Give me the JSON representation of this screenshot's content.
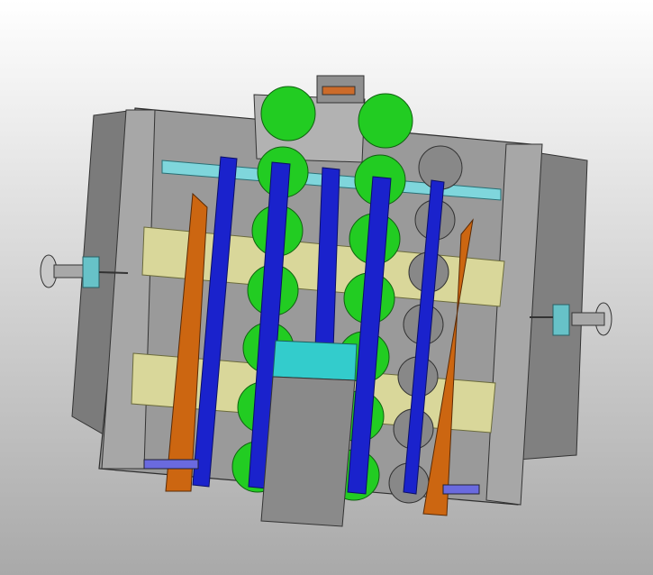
{
  "viewer": {
    "background_top": "#ffffff",
    "background_bottom": "#a9a9a9"
  },
  "model": {
    "colors": {
      "frame_gray": "#8a8a8a",
      "panel_gray": "#7a7a7a",
      "wheel_green": "#22cc22",
      "belt_blue": "#1a22cc",
      "guide_orange": "#cc6611",
      "rail_yellow": "#d9d79a",
      "shaft_cyan": "#7fd6dc",
      "block_cyan": "#33cccc",
      "roller_gray": "#888888"
    },
    "icons": [
      "left-adjust-knob-icon",
      "right-adjust-knob-icon"
    ]
  }
}
